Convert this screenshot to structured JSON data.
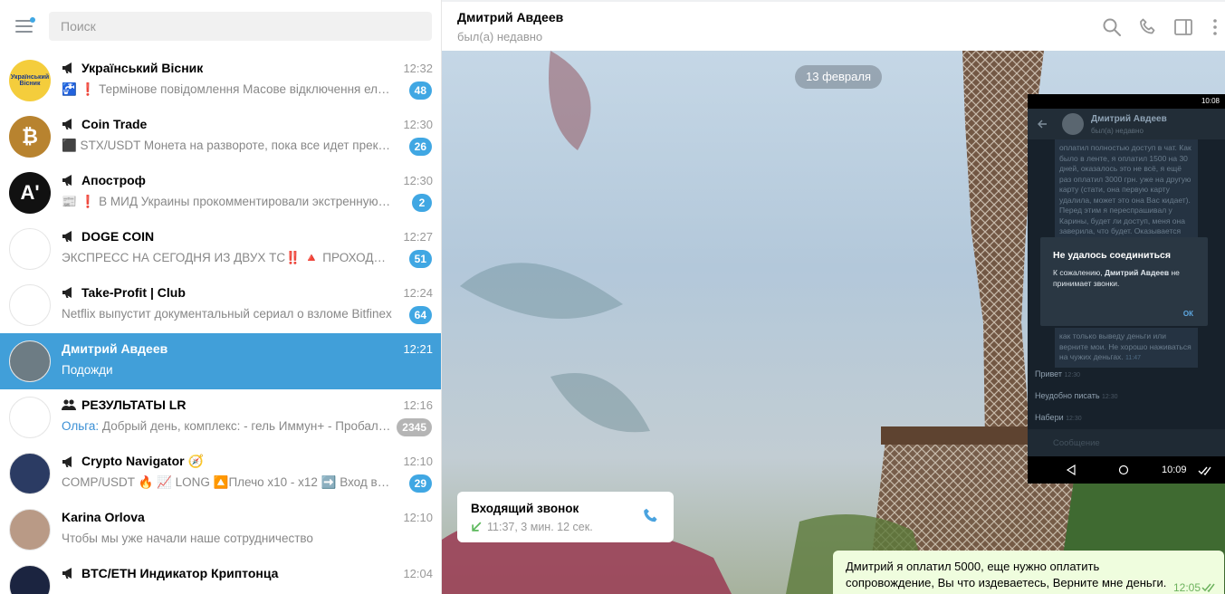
{
  "search": {
    "placeholder": "Поиск"
  },
  "chats": [
    {
      "title": "Український Вісник",
      "kind": "channel",
      "time": "12:32",
      "preview": "🚰 ❗ Термінове повідомлення   Масове відключення електроенергії",
      "badge": "48",
      "muted": false,
      "avatar_text": "Український Вісник",
      "avatar_color": "#f4cd3c"
    },
    {
      "title": "Coin Trade",
      "kind": "channel",
      "time": "12:30",
      "preview": "⬛ STX/USDT  Монета на развороте, пока все идет прекрасно",
      "badge": "26",
      "muted": false,
      "avatar_text": "₿",
      "avatar_color": "#b8832f"
    },
    {
      "title": "Апостроф",
      "kind": "channel",
      "time": "12:30",
      "preview": "📰 ❗ В МИД Украины прокомментировали экстренную помощь",
      "badge": "2",
      "muted": false,
      "avatar_text": "A'",
      "avatar_color": "#111111"
    },
    {
      "title": "DOGE COIN",
      "kind": "channel",
      "time": "12:27",
      "preview": "ЭКСПРЕСС НА СЕГОДНЯ ИЗ ДВУХ ТС‼️  🔺 ПРОХОДИМОСТЬ",
      "badge": "51",
      "muted": false,
      "avatar_text": "",
      "avatar_color": "#ffffff"
    },
    {
      "title": "Take-Profit | Club",
      "kind": "channel",
      "time": "12:24",
      "preview": "Netflix выпустит документальный сериал о взломе Bitfinex",
      "badge": "64",
      "muted": false,
      "avatar_text": "",
      "avatar_color": "#ffffff"
    },
    {
      "title": "Дмитрий Авдеев",
      "kind": "user",
      "time": "12:21",
      "preview": "Подожди",
      "badge": "",
      "muted": false,
      "avatar_text": "",
      "avatar_color": "#6d7c84"
    },
    {
      "title": "РЕЗУЛЬТАТЫ LR",
      "kind": "group",
      "time": "12:16",
      "sender": "Ольга:",
      "preview": " Добрый день, комплекс:  - гель Иммун+ - Пробалансер",
      "badge": "2345",
      "muted": true,
      "avatar_text": "",
      "avatar_color": "#ffffff"
    },
    {
      "title": "Crypto Navigator 🧭",
      "kind": "channel",
      "time": "12:10",
      "preview": "COMP/USDT 🔥  📈 LONG  🔼Плечо x10 - x12  ➡️ Вход в рамках",
      "badge": "29",
      "muted": false,
      "avatar_text": "",
      "avatar_color": "#2b3b63"
    },
    {
      "title": "Karina Orlova",
      "kind": "user",
      "time": "12:10",
      "preview": "Чтобы мы уже начали наше сотрудничество",
      "badge": "",
      "muted": false,
      "avatar_text": "",
      "avatar_color": "#b99a86"
    },
    {
      "title": "BTC/ETH Индикатор Криптонца",
      "kind": "channel",
      "time": "12:04",
      "preview": "",
      "badge": "",
      "muted": false,
      "avatar_text": "",
      "avatar_color": "#1b2440"
    }
  ],
  "conversation": {
    "name": "Дмитрий Авдеев",
    "status": "был(а) недавно",
    "date_chip": "13 февраля",
    "call": {
      "title": "Входящий звонок",
      "meta": "11:37, 3 мин. 12 сек."
    },
    "outgoing": {
      "text": "Дмитрий я оплатил 5000, еще нужно оплатить сопровождение, Вы что издеваетесь, Верните мне деньги.",
      "time": "12:05"
    }
  },
  "phone_screenshot": {
    "status_time": "10:08",
    "header_name": "Дмитрий Авдеев",
    "header_sub": "был(а) недавно",
    "message_top": "оплатил полностью доступ в чат. Как было в ленте, я оплатил 1500 на 30 дней, оказалось это не всё, я ещё раз оплатил 3000 грн. уже на другую карту (стати, она первую карту удалила, может это она Вас кидает). Перед этим я переспрашивал у Карины, будет ли доступ, меня она заверила, что будет. Оказывается",
    "dialog_title": "Не удалось соединиться",
    "dialog_body_prefix": "К сожалению, ",
    "dialog_body_name": "Дмитрий Авдеев",
    "dialog_body_suffix": " не принимает звонки.",
    "dialog_ok": "ОК",
    "message_bottom": "как только выведу деньги или верните мои. Не хорошо наживаться на чужих деньгах.",
    "message_bottom_time": "11:47",
    "incoming": [
      {
        "text": "Привет",
        "time": "12:30"
      },
      {
        "text": "Неудобно писать",
        "time": "12:30"
      },
      {
        "text": "Набери",
        "time": "12:30"
      }
    ],
    "input_placeholder": "Сообщение",
    "nav_time": "10:09"
  },
  "colors": {
    "accent": "#419fd9",
    "badge": "#40a7e3",
    "muted_badge": "#b5b5b5",
    "outgoing_bubble": "#effdde"
  }
}
